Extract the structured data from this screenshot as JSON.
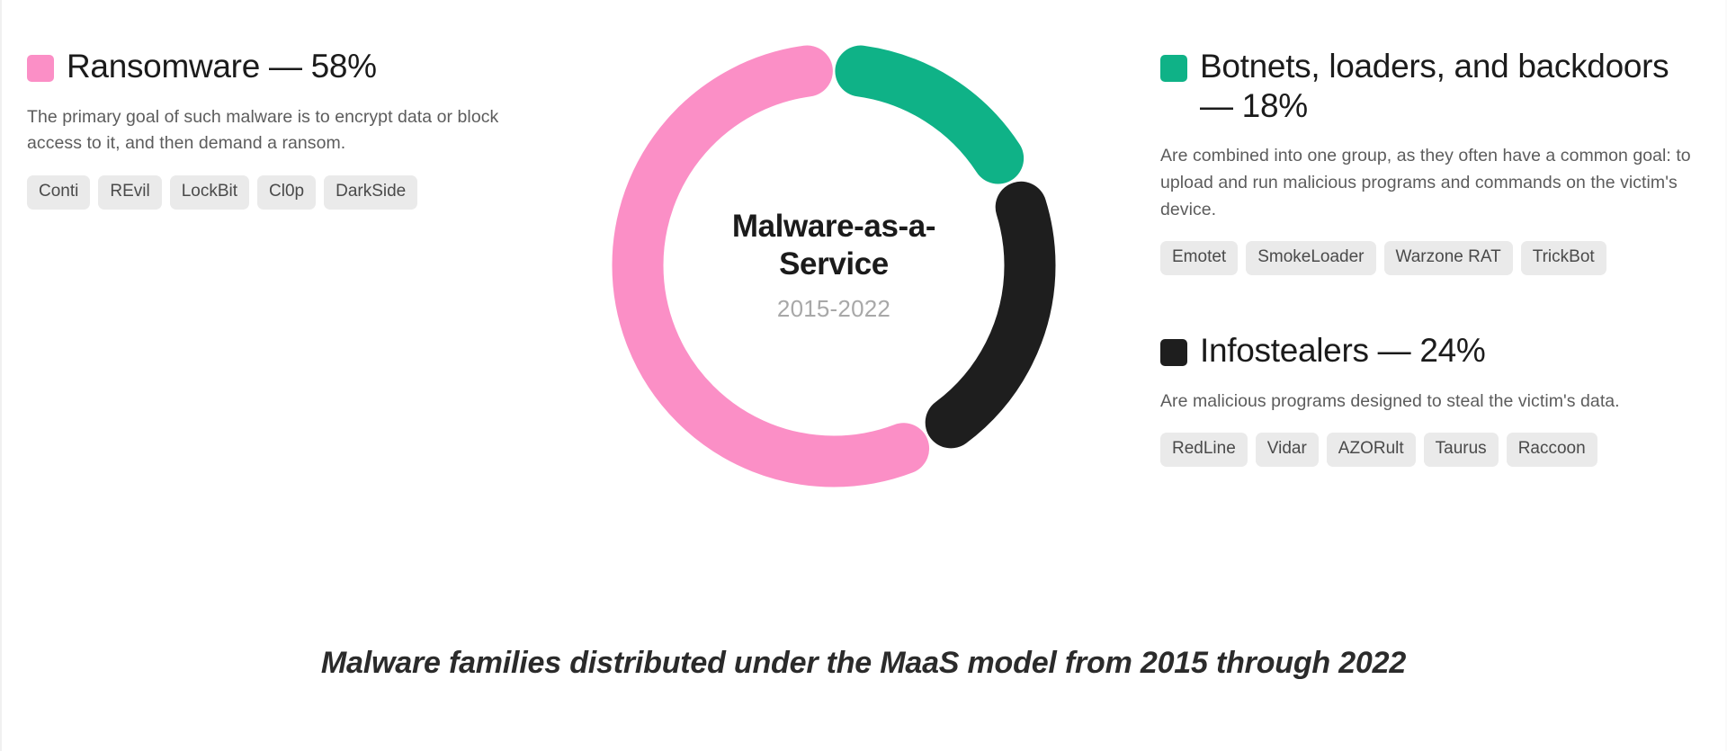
{
  "chart_data": {
    "type": "pie",
    "title": "Malware-as-a-Service",
    "subtitle": "2015-2022",
    "caption": "Malware families distributed under the MaaS model from 2015 through 2022",
    "categories": [
      "Ransomware",
      "Botnets, loaders, and backdoors",
      "Infostealers"
    ],
    "values": [
      58,
      18,
      24
    ],
    "unit": "%",
    "colors": [
      "#FB8FC6",
      "#0FB287",
      "#1E1E1E"
    ],
    "donut": true,
    "start_angle_deg": 0,
    "direction": "clockwise",
    "segment_order": [
      "Botnets, loaders, and backdoors",
      "Infostealers",
      "Ransomware"
    ],
    "legend_position": "sides",
    "grid": false
  },
  "center": {
    "title": "Malware-as-a-Service",
    "subtitle": "2015-2022"
  },
  "caption": {
    "text": "Malware families distributed under the MaaS model from 2015 through 2022"
  },
  "left_column": [
    {
      "key": "ransomware",
      "color": "#FB8FC6",
      "title": "Ransomware — 58%",
      "percent": 58,
      "description": "The primary goal of such malware is to encrypt data or block access to it, and then demand a ransom.",
      "families": [
        "Conti",
        "REvil",
        "LockBit",
        "Cl0p",
        "DarkSide"
      ]
    }
  ],
  "right_column": [
    {
      "key": "botnets",
      "color": "#0FB287",
      "title": "Botnets, loaders, and backdoors — 18%",
      "percent": 18,
      "description": "Are combined into one group, as they often have a common goal: to upload and run malicious programs and commands on the victim's device.",
      "families": [
        "Emotet",
        "SmokeLoader",
        "Warzone RAT",
        "TrickBot"
      ]
    },
    {
      "key": "infostealers",
      "color": "#1E1E1E",
      "title": "Infostealers — 24%",
      "percent": 24,
      "description": "Are malicious programs designed to steal the victim's data.",
      "families": [
        "RedLine",
        "Vidar",
        "AZORult",
        "Taurus",
        "Raccoon"
      ]
    }
  ]
}
